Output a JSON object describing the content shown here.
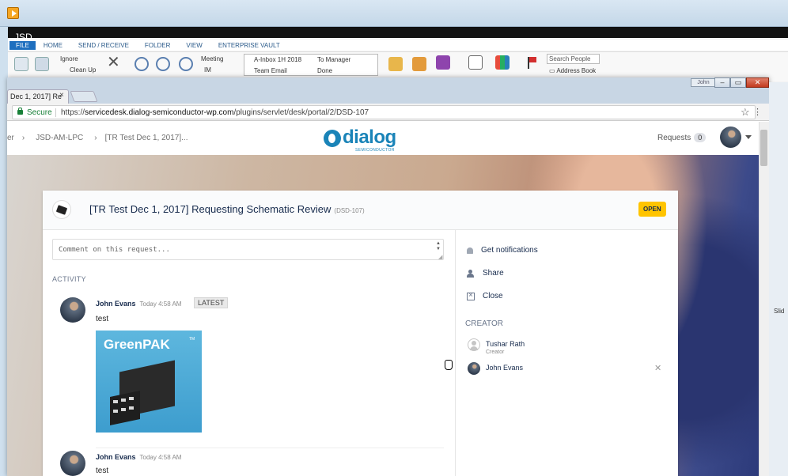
{
  "outlook": {
    "app_title": "JSD",
    "tabs": [
      "FILE",
      "HOME",
      "SEND / RECEIVE",
      "FOLDER",
      "VIEW",
      "ENTERPRISE VAULT"
    ],
    "ribbon": {
      "ignore": "Ignore",
      "clean_up": "Clean Up",
      "meeting": "Meeting",
      "im": "IM",
      "inbox": "A-Inbox 1H 2018",
      "to_manager": "To Manager",
      "team_email": "Team Email",
      "done": "Done",
      "search_people": "Search People",
      "address_book": "Address Book"
    }
  },
  "browser": {
    "tab_title": "Dec 1, 2017] Re",
    "tab_close": "×",
    "win_user": "John",
    "url_secure": "Secure",
    "url_scheme": "https://",
    "url_host": "servicedesk.dialog-semiconductor-wp.com",
    "url_path": "/plugins/servlet/desk/portal/2/DSD-107"
  },
  "portal": {
    "breadcrumbs": [
      "er",
      "JSD-AM-LPC",
      "[TR Test Dec 1, 2017]..."
    ],
    "logo_text": "dialog",
    "logo_sub": "SEMICONDUCTOR",
    "requests_label": "Requests",
    "requests_count": "0"
  },
  "request": {
    "title": "[TR Test Dec 1, 2017] Requesting Schematic Review",
    "key": "(DSD-107)",
    "status": "OPEN",
    "comment_placeholder": "Comment on this request...",
    "activity_label": "ACTIVITY",
    "activities": [
      {
        "author": "John Evans",
        "time": "Today 4:58 AM",
        "badge": "LATEST",
        "text": "test",
        "attachment": "GreenPAK"
      },
      {
        "author": "John Evans",
        "time": "Today 4:58 AM",
        "text": "test"
      }
    ]
  },
  "sidebar": {
    "get_notifications": "Get notifications",
    "share": "Share",
    "close": "Close",
    "creator_label": "CREATOR",
    "people": [
      {
        "name": "Tushar Rath",
        "role": "Creator"
      },
      {
        "name": "John Evans",
        "role": ""
      }
    ]
  },
  "right_strip_text": "Slid"
}
